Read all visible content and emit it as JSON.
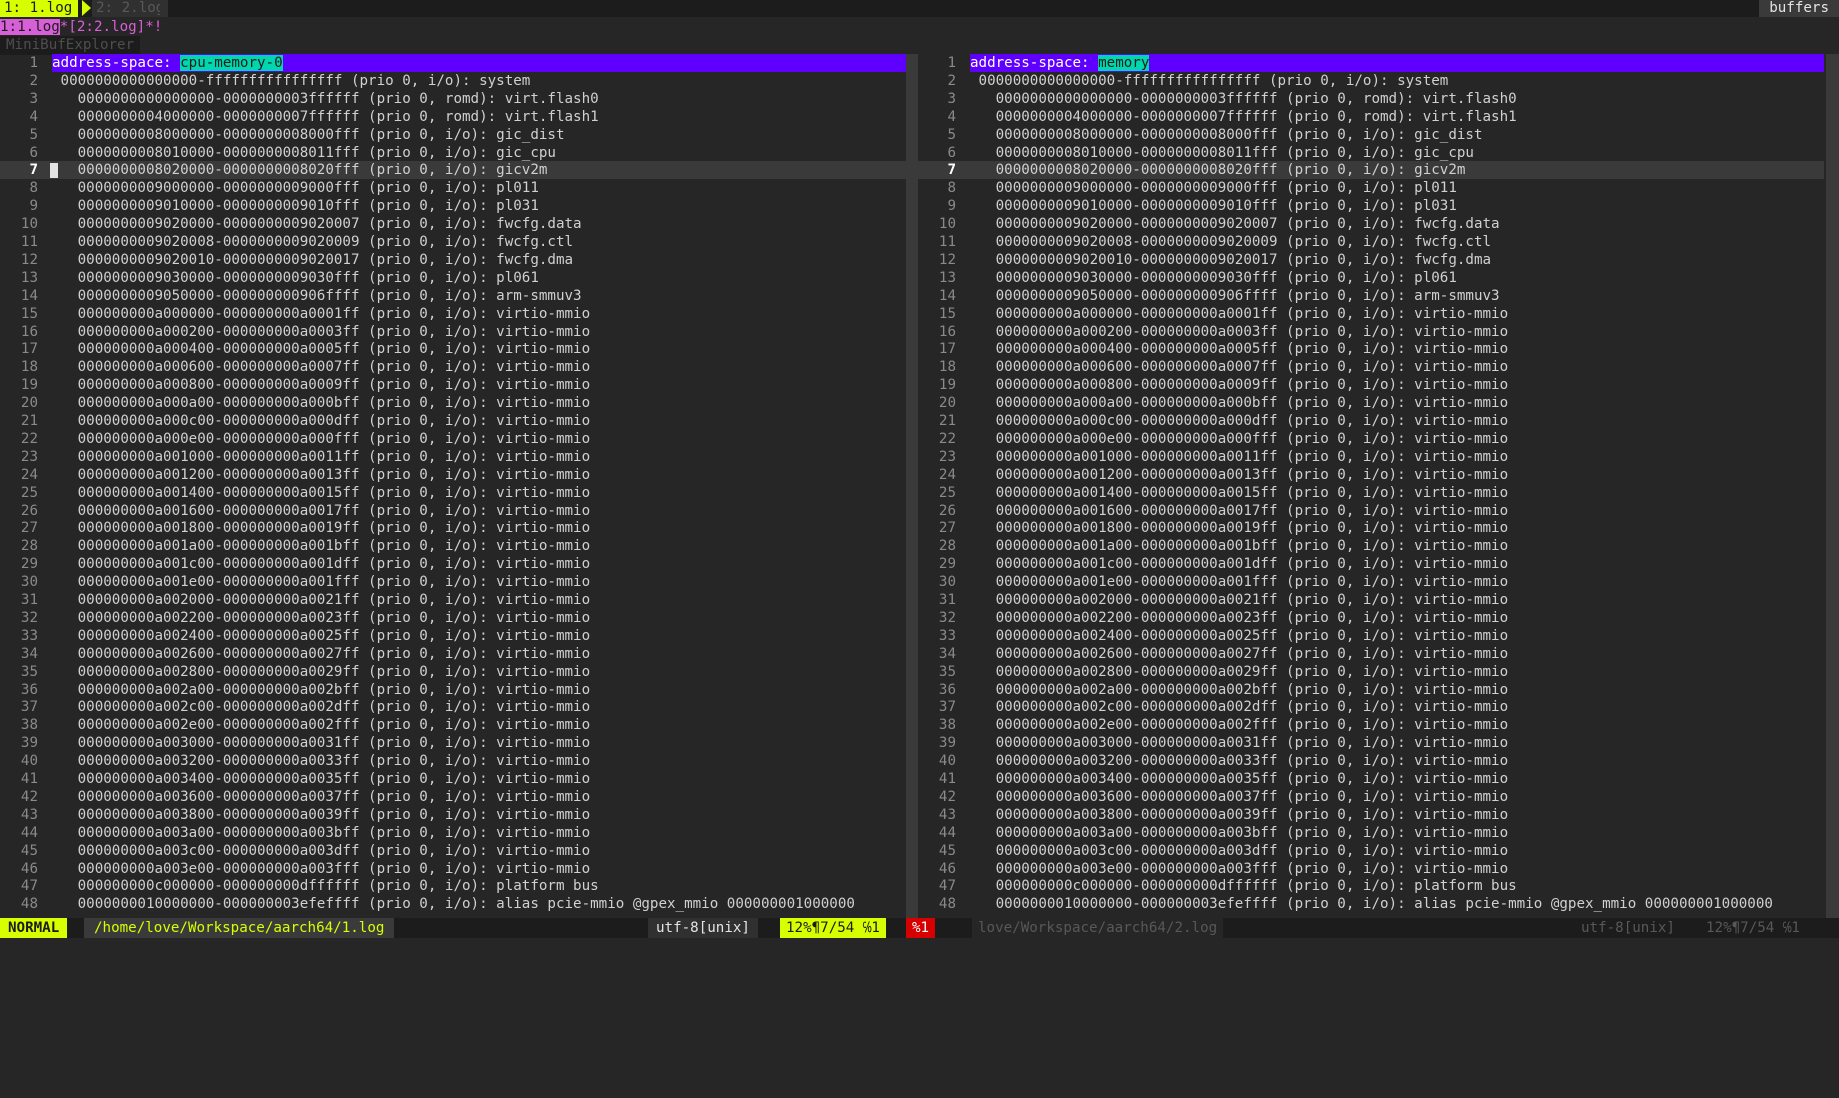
{
  "tabline": {
    "active_tab": "1: 1.log",
    "inactive_tab": "2: 2.log",
    "buffers_label": "buffers"
  },
  "minibuf": {
    "current": "1:1.log",
    "rest": "*[2:2.log]*!",
    "title": "MiniBufExplorer"
  },
  "left": {
    "address_space_key": "address-space: ",
    "address_space_name": "cpu-memory-0"
  },
  "right": {
    "address_space_key": "address-space: ",
    "address_space_name": "memory"
  },
  "cursor_line": 7,
  "lines": [
    " 0000000000000000-ffffffffffffffff (prio 0, i/o): system",
    "   0000000000000000-0000000003ffffff (prio 0, romd): virt.flash0",
    "   0000000004000000-0000000007ffffff (prio 0, romd): virt.flash1",
    "   0000000008000000-0000000008000fff (prio 0, i/o): gic_dist",
    "   0000000008010000-0000000008011fff (prio 0, i/o): gic_cpu",
    "   0000000008020000-0000000008020fff (prio 0, i/o): gicv2m",
    "   0000000009000000-0000000009000fff (prio 0, i/o): pl011",
    "   0000000009010000-0000000009010fff (prio 0, i/o): pl031",
    "   0000000009020000-0000000009020007 (prio 0, i/o): fwcfg.data",
    "   0000000009020008-0000000009020009 (prio 0, i/o): fwcfg.ctl",
    "   0000000009020010-0000000009020017 (prio 0, i/o): fwcfg.dma",
    "   0000000009030000-0000000009030fff (prio 0, i/o): pl061",
    "   0000000009050000-000000000906ffff (prio 0, i/o): arm-smmuv3",
    "   000000000a000000-000000000a0001ff (prio 0, i/o): virtio-mmio",
    "   000000000a000200-000000000a0003ff (prio 0, i/o): virtio-mmio",
    "   000000000a000400-000000000a0005ff (prio 0, i/o): virtio-mmio",
    "   000000000a000600-000000000a0007ff (prio 0, i/o): virtio-mmio",
    "   000000000a000800-000000000a0009ff (prio 0, i/o): virtio-mmio",
    "   000000000a000a00-000000000a000bff (prio 0, i/o): virtio-mmio",
    "   000000000a000c00-000000000a000dff (prio 0, i/o): virtio-mmio",
    "   000000000a000e00-000000000a000fff (prio 0, i/o): virtio-mmio",
    "   000000000a001000-000000000a0011ff (prio 0, i/o): virtio-mmio",
    "   000000000a001200-000000000a0013ff (prio 0, i/o): virtio-mmio",
    "   000000000a001400-000000000a0015ff (prio 0, i/o): virtio-mmio",
    "   000000000a001600-000000000a0017ff (prio 0, i/o): virtio-mmio",
    "   000000000a001800-000000000a0019ff (prio 0, i/o): virtio-mmio",
    "   000000000a001a00-000000000a001bff (prio 0, i/o): virtio-mmio",
    "   000000000a001c00-000000000a001dff (prio 0, i/o): virtio-mmio",
    "   000000000a001e00-000000000a001fff (prio 0, i/o): virtio-mmio",
    "   000000000a002000-000000000a0021ff (prio 0, i/o): virtio-mmio",
    "   000000000a002200-000000000a0023ff (prio 0, i/o): virtio-mmio",
    "   000000000a002400-000000000a0025ff (prio 0, i/o): virtio-mmio",
    "   000000000a002600-000000000a0027ff (prio 0, i/o): virtio-mmio",
    "   000000000a002800-000000000a0029ff (prio 0, i/o): virtio-mmio",
    "   000000000a002a00-000000000a002bff (prio 0, i/o): virtio-mmio",
    "   000000000a002c00-000000000a002dff (prio 0, i/o): virtio-mmio",
    "   000000000a002e00-000000000a002fff (prio 0, i/o): virtio-mmio",
    "   000000000a003000-000000000a0031ff (prio 0, i/o): virtio-mmio",
    "   000000000a003200-000000000a0033ff (prio 0, i/o): virtio-mmio",
    "   000000000a003400-000000000a0035ff (prio 0, i/o): virtio-mmio",
    "   000000000a003600-000000000a0037ff (prio 0, i/o): virtio-mmio",
    "   000000000a003800-000000000a0039ff (prio 0, i/o): virtio-mmio",
    "   000000000a003a00-000000000a003bff (prio 0, i/o): virtio-mmio",
    "   000000000a003c00-000000000a003dff (prio 0, i/o): virtio-mmio",
    "   000000000a003e00-000000000a003fff (prio 0, i/o): virtio-mmio",
    "   000000000c000000-000000000dffffff (prio 0, i/o): platform bus",
    "   0000000010000000-000000003efeffff (prio 0, i/o): alias pcie-mmio @gpex_mmio 000000001000000"
  ],
  "status": {
    "mode": "NORMAL",
    "left_path": "/home/love/Workspace/aarch64/1.log",
    "left_encoding": "utf-8[unix]",
    "left_position": "12%¶7/54 ℅1",
    "warning": "%1",
    "right_path": "love/Workspace/aarch64/2.log",
    "right_encoding": "utf-8[unix]",
    "right_position": "12%¶7/54 ℅1"
  },
  "colors": {
    "mode_bg": "#d7ff00",
    "address_space_bar": "#5f00ff",
    "address_space_name_bg": "#00d7af"
  }
}
